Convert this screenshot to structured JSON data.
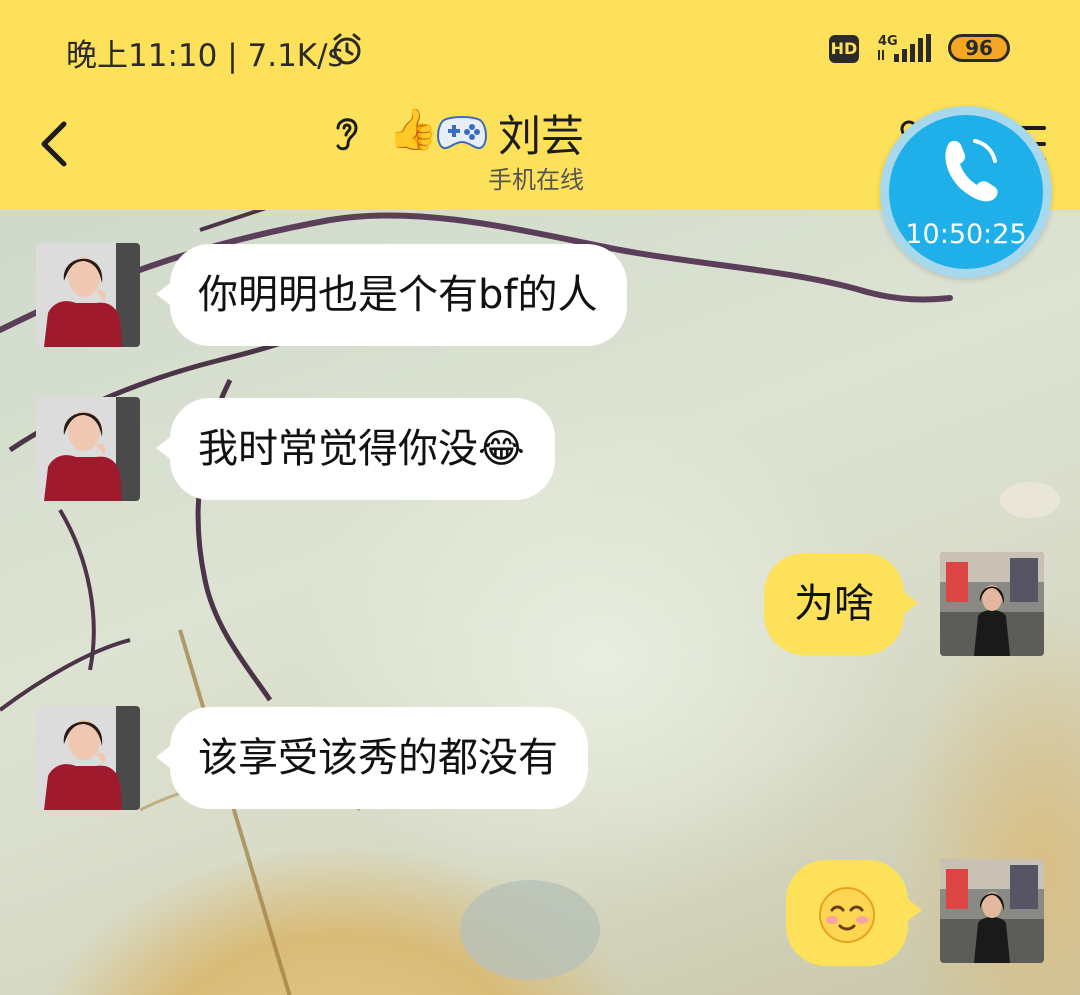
{
  "status_bar": {
    "time_speed": "晚上11:10 | 7.1K/s",
    "alarm_icon": "alarm-clock-icon",
    "hd_label": "HD",
    "network_label": "4G",
    "battery_level": "96",
    "battery_color": "#f5a623"
  },
  "header": {
    "back_icon": "chevron-left-icon",
    "contact_name": "刘芸",
    "contact_status": "手机在线",
    "icons": [
      "ear-icon",
      "thumbs-up-icon",
      "gamepad-icon",
      "person-icon",
      "menu-icon"
    ],
    "thumb_emoji": "👍",
    "background_color": "#fde15a"
  },
  "call_bubble": {
    "icon": "phone-icon",
    "timer": "10:50:25",
    "color": "#1fb0ea"
  },
  "messages": [
    {
      "direction": "incoming",
      "text": "你明明也是个有bf的人"
    },
    {
      "direction": "incoming",
      "text": "我时常觉得你没",
      "emoji": "😂"
    },
    {
      "direction": "outgoing",
      "text": "为啥"
    },
    {
      "direction": "incoming",
      "text": "该享受该秀的都没有"
    },
    {
      "direction": "outgoing",
      "text": "",
      "emoji": "🥴"
    }
  ],
  "colors": {
    "incoming_bubble": "#ffffff",
    "outgoing_bubble": "#fde15a"
  }
}
